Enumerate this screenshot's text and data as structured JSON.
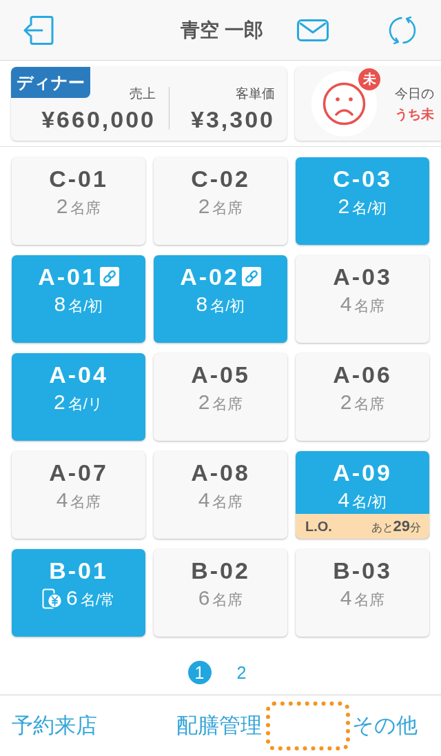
{
  "header": {
    "title": "青空 一郎"
  },
  "summary": {
    "meal_period": "ディナー",
    "stats": [
      {
        "label": "売上",
        "value": "¥660,000"
      },
      {
        "label": "客単価",
        "value": "¥3,300"
      }
    ]
  },
  "feedback": {
    "badge": "未",
    "title": "今日の",
    "subtitle": "うち未"
  },
  "tables": [
    {
      "name": "C-01",
      "occupied": false,
      "linked": false,
      "mobile_payment": false,
      "count": "2",
      "unit": "名席"
    },
    {
      "name": "C-02",
      "occupied": false,
      "linked": false,
      "mobile_payment": false,
      "count": "2",
      "unit": "名席"
    },
    {
      "name": "C-03",
      "occupied": true,
      "linked": false,
      "mobile_payment": false,
      "count": "2",
      "unit": "名/初"
    },
    {
      "name": "A-01",
      "occupied": true,
      "linked": true,
      "mobile_payment": false,
      "count": "8",
      "unit": "名/初"
    },
    {
      "name": "A-02",
      "occupied": true,
      "linked": true,
      "mobile_payment": false,
      "count": "8",
      "unit": "名/初"
    },
    {
      "name": "A-03",
      "occupied": false,
      "linked": false,
      "mobile_payment": false,
      "count": "4",
      "unit": "名席"
    },
    {
      "name": "A-04",
      "occupied": true,
      "linked": false,
      "mobile_payment": false,
      "count": "2",
      "unit": "名/リ"
    },
    {
      "name": "A-05",
      "occupied": false,
      "linked": false,
      "mobile_payment": false,
      "count": "2",
      "unit": "名席"
    },
    {
      "name": "A-06",
      "occupied": false,
      "linked": false,
      "mobile_payment": false,
      "count": "2",
      "unit": "名席"
    },
    {
      "name": "A-07",
      "occupied": false,
      "linked": false,
      "mobile_payment": false,
      "count": "4",
      "unit": "名席"
    },
    {
      "name": "A-08",
      "occupied": false,
      "linked": false,
      "mobile_payment": false,
      "count": "4",
      "unit": "名席"
    },
    {
      "name": "A-09",
      "occupied": true,
      "linked": false,
      "mobile_payment": false,
      "count": "4",
      "unit": "名/初",
      "last_order": {
        "label": "L.O.",
        "remaining": "あと**29**分"
      }
    },
    {
      "name": "B-01",
      "occupied": true,
      "linked": false,
      "mobile_payment": true,
      "count": "6",
      "unit": "名/常"
    },
    {
      "name": "B-02",
      "occupied": false,
      "linked": false,
      "mobile_payment": false,
      "count": "6",
      "unit": "名席"
    },
    {
      "name": "B-03",
      "occupied": false,
      "linked": false,
      "mobile_payment": false,
      "count": "4",
      "unit": "名席"
    }
  ],
  "pagination": [
    {
      "label": "1",
      "selected": true
    },
    {
      "label": "2",
      "selected": false
    }
  ],
  "bottom_nav": [
    {
      "label": "予約来店"
    },
    {
      "label": "配膳管理"
    },
    {
      "label": "その他"
    }
  ]
}
